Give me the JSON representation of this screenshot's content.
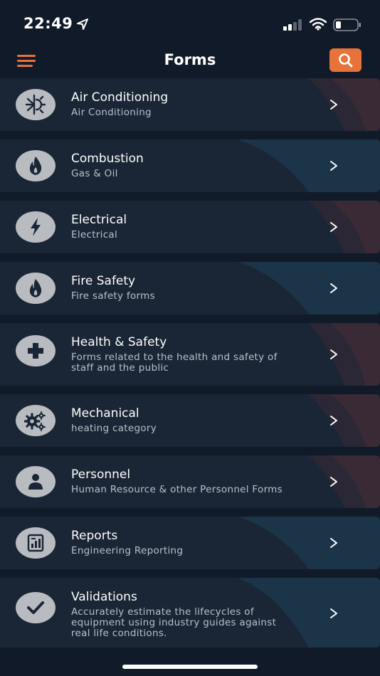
{
  "status_bar": {
    "time": "22:49",
    "icons": [
      "location-arrow-icon",
      "cellular-signal-icon",
      "wifi-icon",
      "battery-icon"
    ]
  },
  "header": {
    "title": "Forms",
    "menu_icon": "hamburger-menu-icon",
    "search_icon": "search-icon"
  },
  "colors": {
    "accent": "#e8733a",
    "background": "#111a28",
    "card": "#1a2535",
    "icon_circle": "#b8bcc1",
    "subtitle": "#b9c0c9"
  },
  "forms": [
    {
      "title": "Air Conditioning",
      "subtitle": "Air Conditioning",
      "icon": "snowflake-sun-icon"
    },
    {
      "title": "Combustion",
      "subtitle": "Gas & Oil",
      "icon": "flame-icon"
    },
    {
      "title": "Electrical",
      "subtitle": "Electrical",
      "icon": "lightning-bolt-icon"
    },
    {
      "title": "Fire Safety",
      "subtitle": "Fire safety forms",
      "icon": "flame-icon"
    },
    {
      "title": "Health & Safety",
      "subtitle": "Forms related to the health and safety of staff and the public",
      "subtitle_lines": [
        "Forms related to the health and safety of",
        "staff and the public"
      ],
      "icon": "medical-cross-icon"
    },
    {
      "title": "Mechanical",
      "subtitle": "heating category",
      "icon": "gears-icon"
    },
    {
      "title": "Personnel",
      "subtitle": "Human Resource & other Personnel Forms",
      "icon": "person-icon"
    },
    {
      "title": "Reports",
      "subtitle": "Engineering Reporting",
      "icon": "report-chart-icon"
    },
    {
      "title": "Validations",
      "subtitle": "Accurately estimate the lifecycles of equipment using industry guides against real life conditions.",
      "subtitle_lines": [
        "Accurately estimate the lifecycles of",
        "equipment using industry guides against",
        "real life conditions."
      ],
      "icon": "checkmark-icon"
    }
  ]
}
